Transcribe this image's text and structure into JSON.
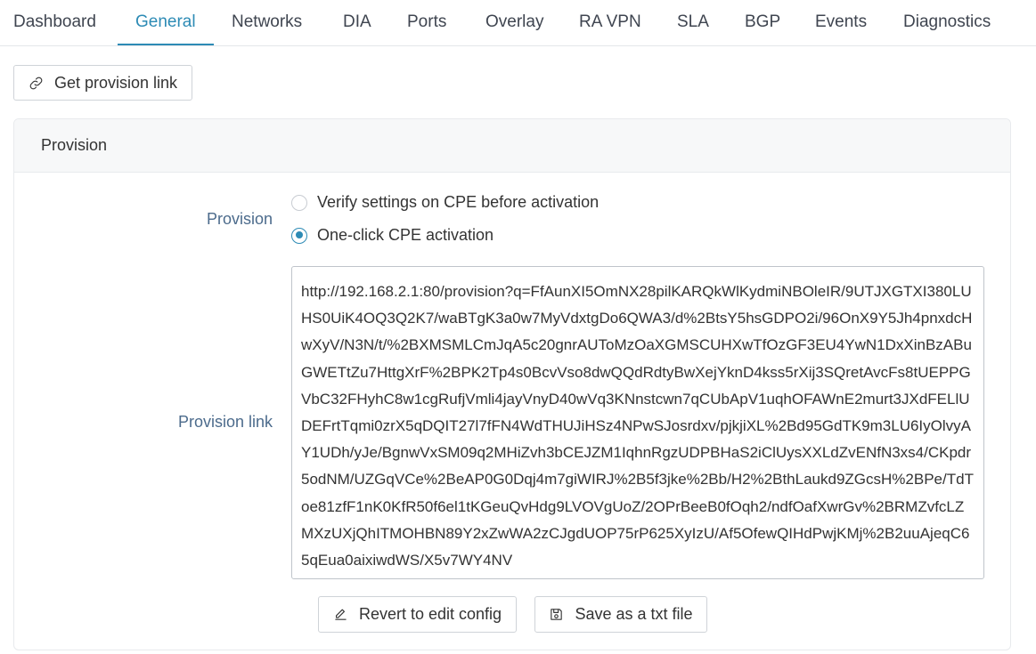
{
  "tabs": [
    {
      "label": "Dashboard"
    },
    {
      "label": "General"
    },
    {
      "label": "Networks"
    },
    {
      "label": "DIA"
    },
    {
      "label": "Ports"
    },
    {
      "label": "Overlay"
    },
    {
      "label": "RA VPN"
    },
    {
      "label": "SLA"
    },
    {
      "label": "BGP"
    },
    {
      "label": "Events"
    },
    {
      "label": "Diagnostics"
    }
  ],
  "active_tab": "General",
  "toolbar": {
    "get_link_label": "Get provision link"
  },
  "panel": {
    "title": "Provision",
    "provision_label": "Provision",
    "options": [
      {
        "label": "Verify settings on CPE before activation",
        "checked": false
      },
      {
        "label": "One-click CPE activation",
        "checked": true
      }
    ],
    "link_label": "Provision link",
    "link_value": "http://192.168.2.1:80/provision?q=FfAunXI5OmNX28pilKARQkWlKydmiNBOleIR/9UTJXGTXI380LUHS0UiK4OQ3Q2K7/waBTgK3a0w7MyVdxtgDo6QWA3/d%2BtsY5hsGDPO2i/96OnX9Y5Jh4pnxdcHwXyV/N3N/t/%2BXMSMLCmJqA5c20gnrAUToMzOaXGMSCUHXwTfOzGF3EU4YwN1DxXinBzABuGWETtZu7HttgXrF%2BPK2Tp4s0BcvVso8dwQQdRdtyBwXejYknD4kss5rXij3SQretAvcFs8tUEPPGVbC32FHyhC8w1cgRufjVmli4jayVnyD40wVq3KNnstcwn7qCUbApV1uqhOFAWnE2murt3JXdFELlUDEFrtTqmi0zrX5qDQIT27l7fFN4WdTHUJiHSz4NPwSJosrdxv/pjkjiXL%2Bd95GdTK9m3LU6IyOlvyAY1UDh/yJe/BgnwVxSM09q2MHiZvh3bCEJZM1IqhnRgzUDPBHaS2iClUysXXLdZvENfN3xs4/CKpdr5odNM/UZGqVCe%2BeAP0G0Dqj4m7giWIRJ%2B5f3jke%2Bb/H2%2BthLaukd9ZGcsH%2BPe/TdToe81zfF1nK0KfR50f6el1tKGeuQvHdg9LVOVgUoZ/2OPrBeeB0fOqh2/ndfOafXwrGv%2BRMZvfcLZMXzUXjQhITMOHBN89Y2xZwWA2zCJgdUOP75rP625XyIzU/Af5OfewQIHdPwjKMj%2B2uuAjeqC65qEua0aixiwdWS/X5v7WY4NV",
    "revert_label": "Revert to edit config",
    "save_label": "Save as a txt file"
  },
  "colors": {
    "accent": "#2d8bb5",
    "label": "#4c6b8c",
    "text": "#333333"
  }
}
